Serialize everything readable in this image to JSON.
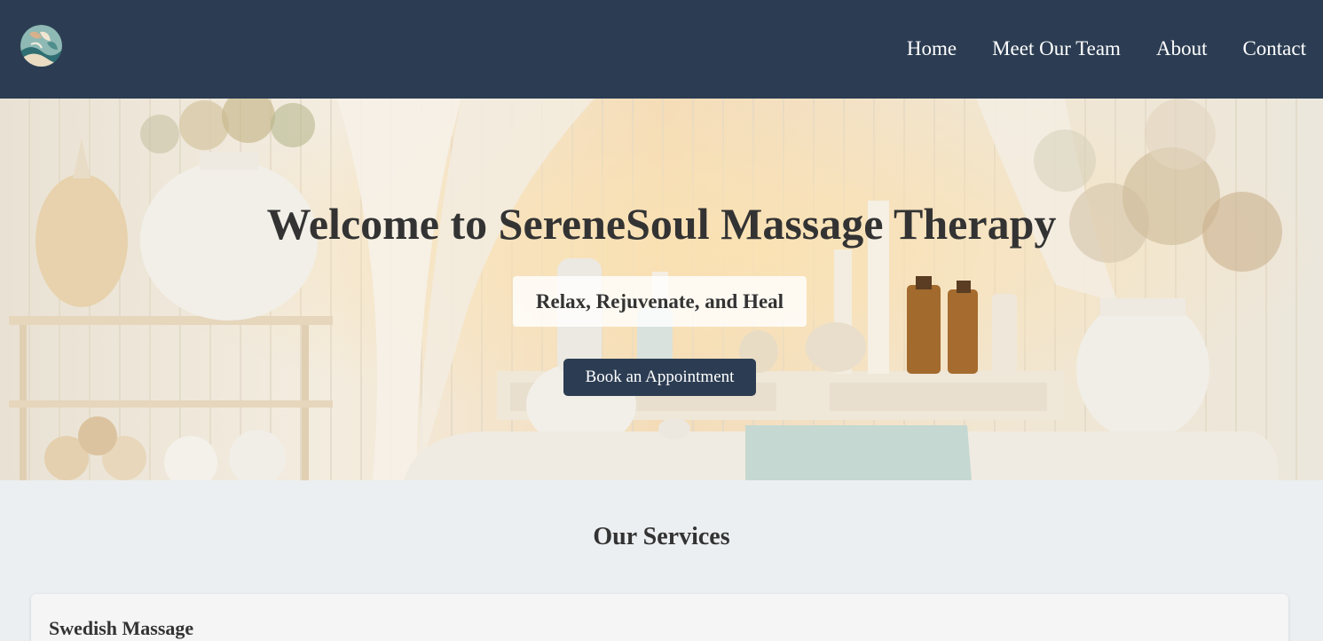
{
  "brand": {
    "logo_icon": "leaf-logo-icon"
  },
  "nav": {
    "items": [
      {
        "label": "Home"
      },
      {
        "label": "Meet Our Team"
      },
      {
        "label": "About"
      },
      {
        "label": "Contact"
      }
    ]
  },
  "hero": {
    "title": "Welcome to SereneSoul Massage Therapy",
    "tagline": "Relax, Rejuvenate, and Heal",
    "cta_label": "Book an Appointment"
  },
  "services": {
    "title": "Our Services",
    "items": [
      {
        "name": "Swedish Massage"
      }
    ]
  },
  "colors": {
    "header_bg": "#2c3d53",
    "page_bg": "#eceff1",
    "text": "#333333",
    "button_bg": "#2c3d53"
  }
}
